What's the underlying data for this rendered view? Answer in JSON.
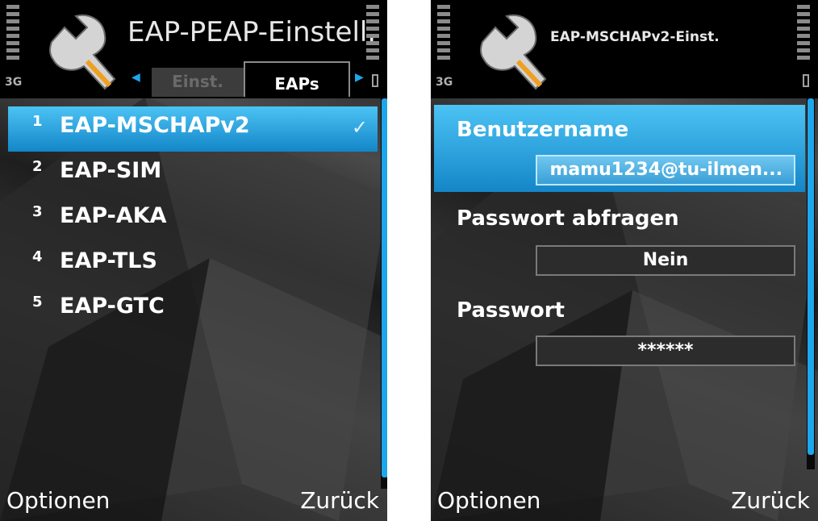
{
  "left_screen": {
    "status": {
      "network": "3G"
    },
    "title": "EAP-PEAP-Einstell.",
    "tabs": [
      {
        "label": "Einst.",
        "active": false
      },
      {
        "label": "EAPs",
        "active": true
      }
    ],
    "items": [
      {
        "number": "1",
        "label": "EAP-MSCHAPv2",
        "selected": true,
        "checked": true
      },
      {
        "number": "2",
        "label": "EAP-SIM",
        "selected": false,
        "checked": false
      },
      {
        "number": "3",
        "label": "EAP-AKA",
        "selected": false,
        "checked": false
      },
      {
        "number": "4",
        "label": "EAP-TLS",
        "selected": false,
        "checked": false
      },
      {
        "number": "5",
        "label": "EAP-GTC",
        "selected": false,
        "checked": false
      }
    ],
    "softkeys": {
      "left": "Optionen",
      "right": "Zurück"
    },
    "colors": {
      "accent": "#1ea6ec",
      "header": "#000000"
    }
  },
  "right_screen": {
    "status": {
      "network": "3G"
    },
    "title": "EAP-MSCHAPv2-Einst.",
    "settings": [
      {
        "label": "Benutzername",
        "value": "mamu1234@tu-ilmen...",
        "selected": true
      },
      {
        "label": "Passwort abfragen",
        "value": "Nein",
        "selected": false
      },
      {
        "label": "Passwort",
        "value": "******",
        "selected": false
      }
    ],
    "softkeys": {
      "left": "Optionen",
      "right": "Zurück"
    }
  },
  "icons": {
    "app": "wrench-icon",
    "check": "✓",
    "tab_left_arrow": "◀",
    "tab_right_arrow": "▶"
  }
}
